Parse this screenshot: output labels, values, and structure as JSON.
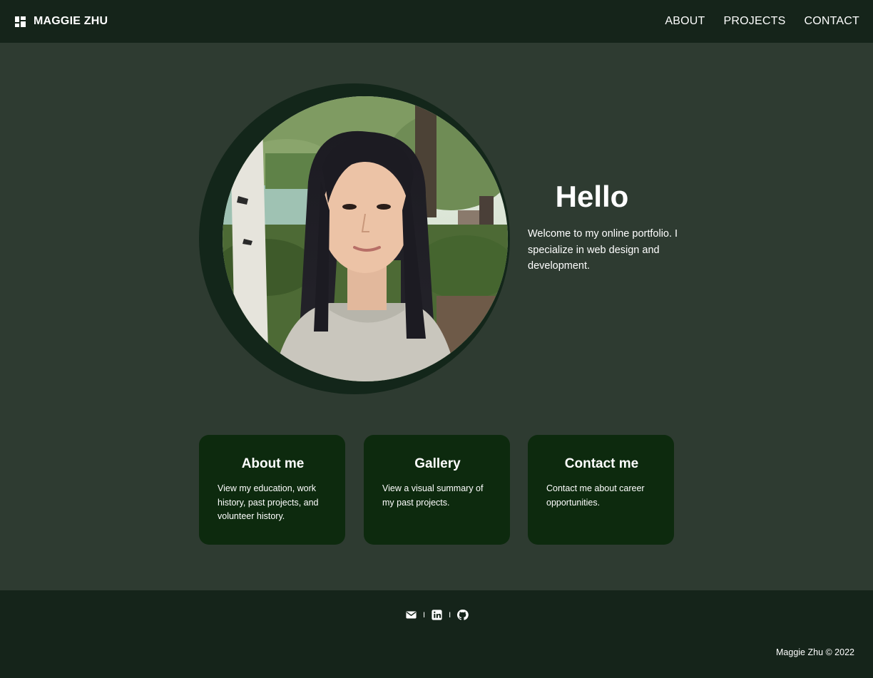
{
  "header": {
    "brand_name": "MAGGIE ZHU",
    "brand_icon": "dashboard-icon",
    "nav": [
      {
        "label": "ABOUT"
      },
      {
        "label": "PROJECTS"
      },
      {
        "label": "CONTACT"
      }
    ]
  },
  "hero": {
    "heading": "Hello",
    "intro": "Welcome to my online portfolio. I specialize in web design and development."
  },
  "cards": [
    {
      "title": "About me",
      "text": "View my education, work history, past projects, and volunteer history."
    },
    {
      "title": "Gallery",
      "text": "View a visual summary of my past projects."
    },
    {
      "title": "Contact me",
      "text": "Contact me about career opportunities."
    }
  ],
  "footer": {
    "separator": "I",
    "socials": [
      "email-icon",
      "linkedin-icon",
      "github-icon"
    ],
    "copyright": "Maggie Zhu © 2022"
  },
  "colors": {
    "page_bg": "#2e3b31",
    "header_bg": "#15241a",
    "card_bg": "#0d2a0e",
    "ring": "#13261a",
    "text": "#ffffff"
  }
}
